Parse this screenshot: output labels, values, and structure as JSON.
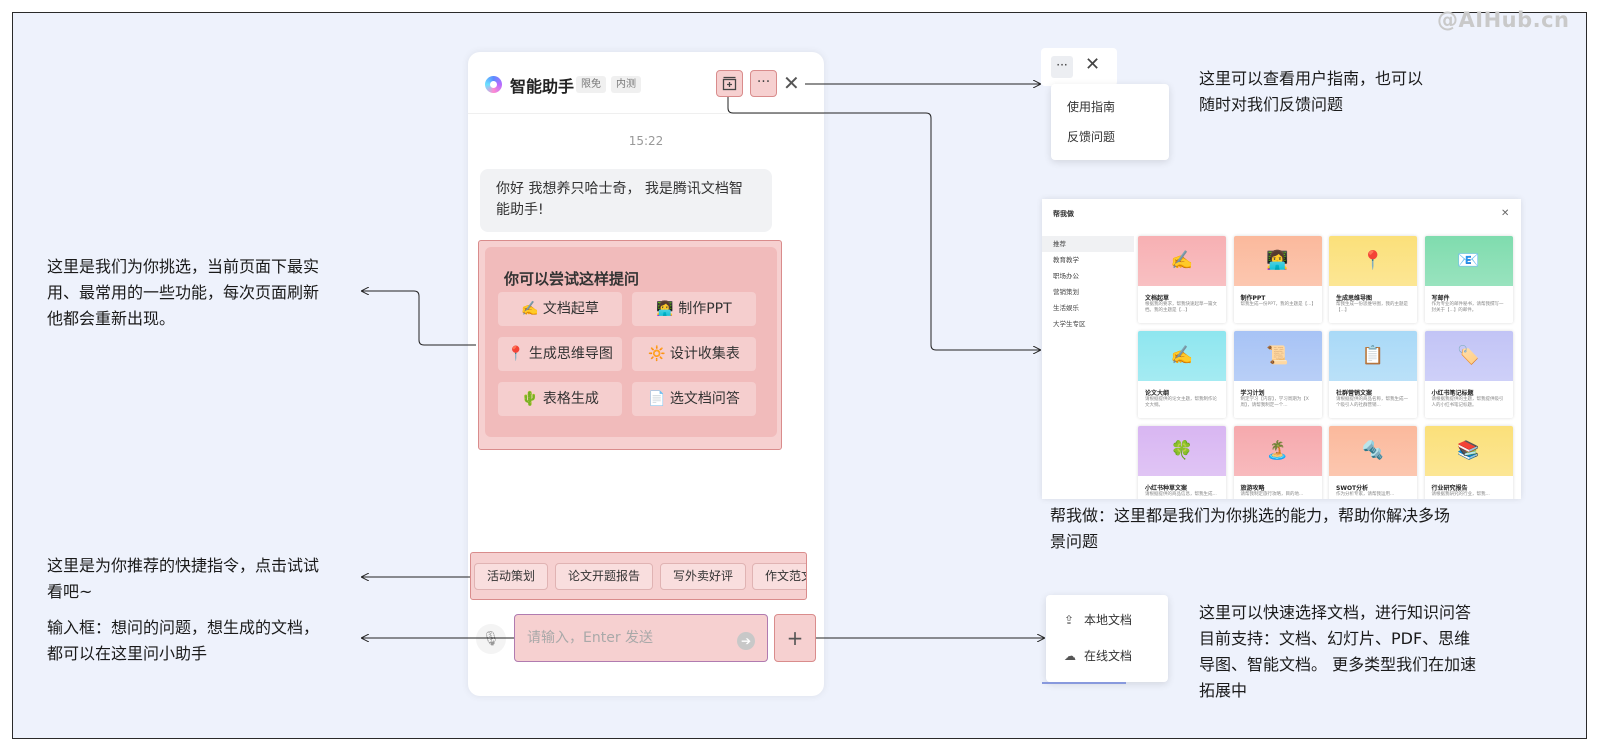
{
  "watermark": "@AIHub.cn",
  "notes": {
    "suggest_l1": "这里是我们为你挑选，当前页面下最实",
    "suggest_l2": "用、最常用的一些功能，每次页面刷新",
    "suggest_l3": "他都会重新出现。",
    "shortcut_l1": "这里是为你推荐的快捷指令，点击试试",
    "shortcut_l2": "看吧~",
    "input_l1": "输入框：想问的问题，想生成的文档，",
    "input_l2": "都可以在这里问小助手",
    "menu_l1": "这里可以查看用户指南，也可以",
    "menu_l2": "随时对我们反馈问题",
    "help_l1": "帮我做：这里都是我们为你挑选的能力，帮助你解决多场",
    "help_l2": "景问题",
    "upload_l1": "这里可以快速选择文档，进行知识问答",
    "upload_l2": "目前支持：文档、幻灯片、PDF、思维",
    "upload_l3": "导图、智能文档。 更多类型我们在加速",
    "upload_l4": "拓展中"
  },
  "chat": {
    "title": "智能助手",
    "tags": [
      "限免",
      "内测"
    ],
    "more_label": "···",
    "close_label": "✕",
    "time": "15:22",
    "greeting": "你好 我想养只哈士奇，  我是腾讯文档智能助手!",
    "suggest_title": "你可以尝试这样提问",
    "suggestions": [
      "✍️ 文档起草",
      "👩‍💻 制作PPT",
      "📍 生成思维导图",
      "🔆 设计收集表",
      "🌵 表格生成",
      "📄 选文档问答"
    ],
    "shortcuts": [
      "活动策划",
      "论文开题报告",
      "写外卖好评",
      "作文范文"
    ],
    "input_placeholder": "请输入，Enter 发送",
    "plus_label": "+"
  },
  "menu": {
    "dots": "···",
    "close": "✕",
    "items": [
      "使用指南",
      "反馈问题"
    ]
  },
  "help_panel": {
    "title": "帮我做",
    "close": "✕",
    "categories": [
      "推荐",
      "教育教学",
      "职场办公",
      "营销策划",
      "生活娱乐",
      "大学生专区"
    ],
    "cards": [
      {
        "title": "文档起草",
        "desc": "根据我的要求，帮我快速起草一篇文档。我的主题是【...】",
        "emoji": "✍️",
        "color": "#f7b0b3"
      },
      {
        "title": "制作PPT",
        "desc": "帮我生成一份PPT，我的主题是【...】",
        "emoji": "👩‍💻",
        "color": "#fbb99c"
      },
      {
        "title": "生成思维导图",
        "desc": "帮我生成一份思维导图，我的主题是【...】",
        "emoji": "📍",
        "color": "#fbe07a"
      },
      {
        "title": "写邮件",
        "desc": "作为专业的邮件秘书，请帮我撰写一封关于【...】的邮件。",
        "emoji": "📧",
        "color": "#7fdcae"
      },
      {
        "title": "论文大纲",
        "desc": "请根据提供的论文主题，帮我制作论文大纲。",
        "emoji": "✍️",
        "color": "#8ee6ef"
      },
      {
        "title": "学习计划",
        "desc": "制定学习【内容】，学习周期为【X周】，请帮我制定一个...",
        "emoji": "📜",
        "color": "#a7c3f5"
      },
      {
        "title": "社群营销文案",
        "desc": "请根据提供的商品名称，帮我生成一个吸引人的社群营销...",
        "emoji": "📋",
        "color": "#a9d9f7"
      },
      {
        "title": "小红书笔记标题",
        "desc": "请根据我提供的主题，帮我提供吸引人的小红书笔记标题。",
        "emoji": "🏷️",
        "color": "#c2c4f6"
      },
      {
        "title": "小红书种草文案",
        "desc": "请根据提供的商品信息，帮我生成...",
        "emoji": "🍀",
        "color": "#d8b6f2"
      },
      {
        "title": "旅游攻略",
        "desc": "请帮我制定旅行攻略，目的地...",
        "emoji": "🏝️",
        "color": "#f6a9ad"
      },
      {
        "title": "SWOT分析",
        "desc": "作为分析专家，请帮我运用...",
        "emoji": "🔩",
        "color": "#fbb99c"
      },
      {
        "title": "行业研究报告",
        "desc": "请根据我研究的行业，帮我...",
        "emoji": "📚",
        "color": "#fbe07a"
      }
    ]
  },
  "upload": {
    "items": [
      {
        "icon": "⇪",
        "label": "本地文档"
      },
      {
        "icon": "☁",
        "label": "在线文档"
      }
    ]
  }
}
